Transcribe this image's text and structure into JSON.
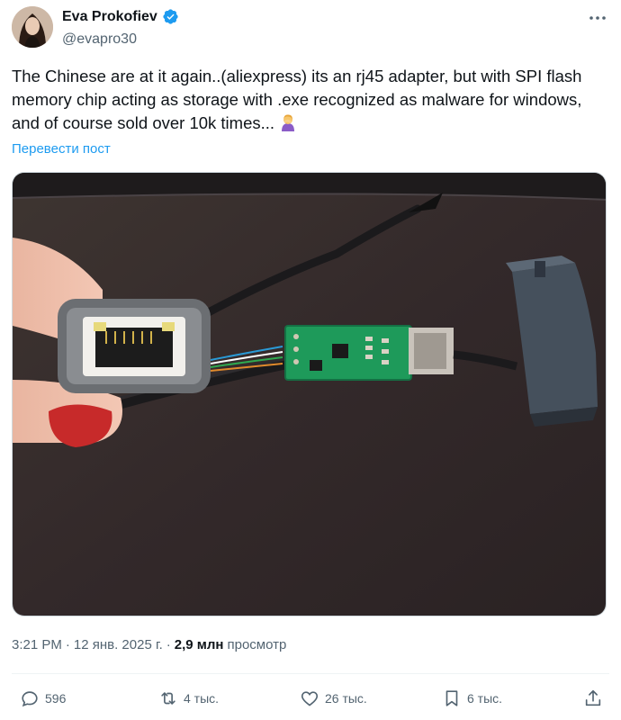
{
  "author": {
    "display_name": "Eva Prokofiev",
    "handle": "@evapro30",
    "verified_icon": "verified-badge-icon",
    "avatar_icon": "profile-avatar"
  },
  "tweet": {
    "text": "The Chinese are at it again..(aliexpress) its an rj45 adapter, but with SPI flash memory chip acting as storage with .exe recognized as malware for windows, and of course sold over 10k times...",
    "emoji_icon": "woman-facepalming-emoji",
    "translate_label": "Перевести пост"
  },
  "media": {
    "type": "photo",
    "icon": "photo-rj45-adapter-with-pcb"
  },
  "meta": {
    "time": "3:21 PM",
    "sep1": "·",
    "date": "12 янв. 2025 г.",
    "sep2": "·",
    "views_count": "2,9 млн",
    "views_label": "просмотр"
  },
  "actions": {
    "replies": "596",
    "reposts": "4 тыс.",
    "likes": "26 тыс.",
    "bookmarks": "6 тыс."
  },
  "colors": {
    "text": "#0f1419",
    "secondary": "#536471",
    "link": "#1d9bf0",
    "verified": "#1d9bf0",
    "border": "#cfd9de"
  }
}
